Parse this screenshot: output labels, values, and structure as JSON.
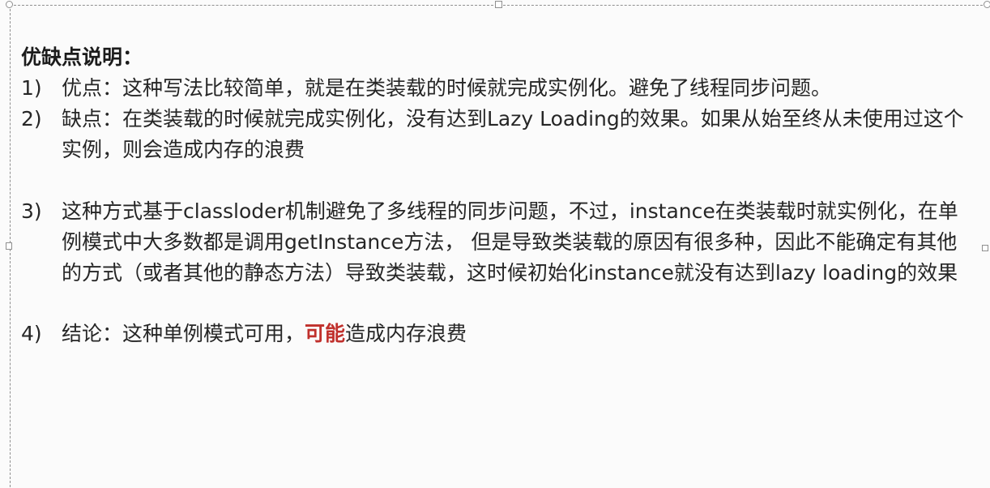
{
  "heading": "优缺点说明：",
  "items": [
    {
      "num": "1)",
      "text": "优点：这种写法比较简单，就是在类装载的时候就完成实例化。避免了线程同步问题。"
    },
    {
      "num": "2)",
      "text": "缺点：在类装载的时候就完成实例化，没有达到Lazy Loading的效果。如果从始至终从未使用过这个实例，则会造成内存的浪费"
    },
    {
      "num": "3)",
      "text": "这种方式基于classloder机制避免了多线程的同步问题，不过，instance在类装载时就实例化，在单例模式中大多数都是调用getInstance方法， 但是导致类装载的原因有很多种，因此不能确定有其他的方式（或者其他的静态方法）导致类装载，这时候初始化instance就没有达到lazy loading的效果"
    },
    {
      "num": "4)",
      "text_before": "结论：这种单例模式可用，",
      "highlight": "可能",
      "text_after": "造成内存浪费"
    }
  ],
  "colors": {
    "highlight": "#c0302c",
    "text": "#262626",
    "frame": "#8f8f8f"
  }
}
